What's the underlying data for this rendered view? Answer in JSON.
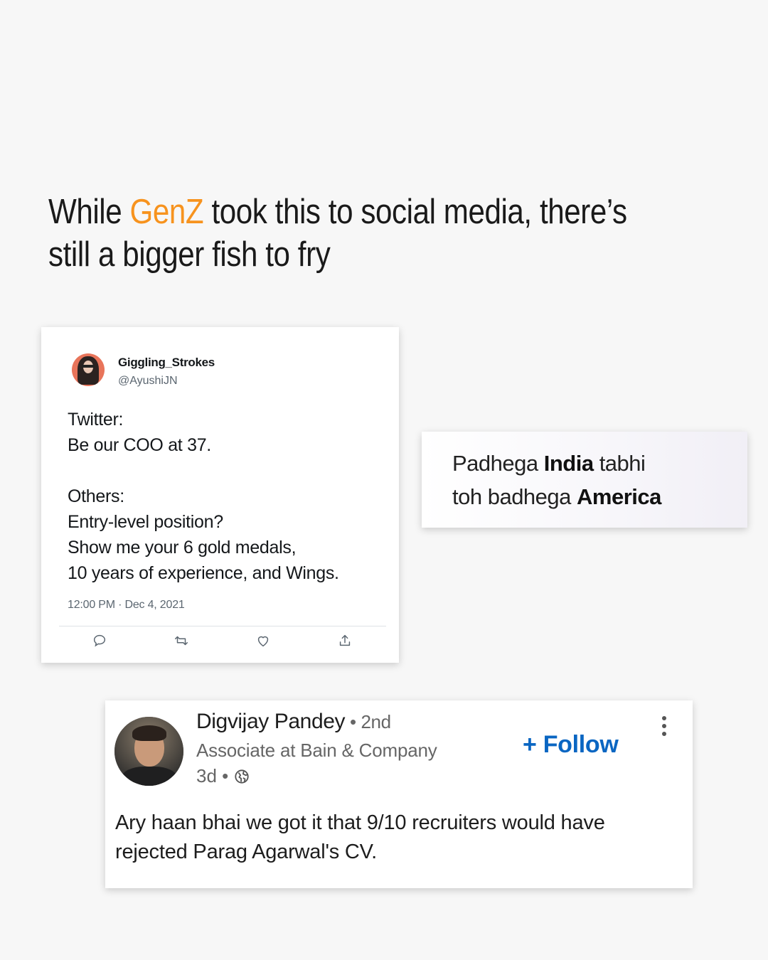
{
  "headline": {
    "prefix": "While ",
    "accent": "GenZ",
    "suffix": " took this to social media, there’s still a bigger fish to fry",
    "accent_color": "#f7931e"
  },
  "tweet": {
    "display_name": "Giggling_Strokes",
    "handle": "@AyushiJN",
    "lines": [
      "Twitter:",
      "Be our COO at 37.",
      "",
      "Others:",
      "Entry-level position?",
      "Show me your 6 gold medals,",
      "10 years of experience, and Wings."
    ],
    "timestamp": "12:00 PM · Dec 4, 2021",
    "actions": [
      "reply-icon",
      "retweet-icon",
      "like-icon",
      "share-icon"
    ]
  },
  "quote": {
    "line1_a": "Padhega ",
    "line1_b": "India",
    "line1_c": " tabhi",
    "line2_a": "toh badhega ",
    "line2_b": "America"
  },
  "linkedin": {
    "name": "Digvijay Pandey",
    "degree": " • 2nd",
    "headline": "Associate at Bain & Company",
    "time": "3d •",
    "follow_label": "+ Follow",
    "post": "Ary haan bhai we got it that 9/10 recruiters would have rejected Parag Agarwal's CV.",
    "accent_color": "#0a66c2"
  }
}
